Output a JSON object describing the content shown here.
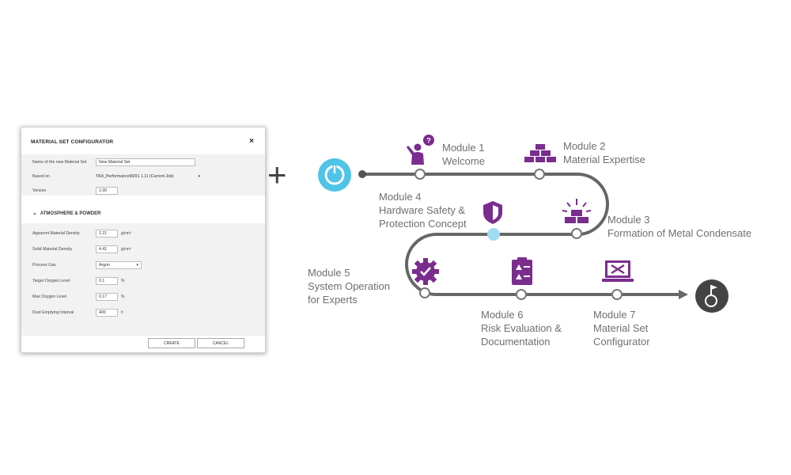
{
  "dialog": {
    "title": "MATERIAL SET CONFIGURATOR",
    "close_symbol": "×",
    "fields": {
      "name_label": "Name of the new Material Set",
      "name_value": "New Material Set",
      "based_on_label": "Based on",
      "based_on_value": "Ti64_PerformanceM291 1.11 (Current Job)",
      "version_label": "Version",
      "version_value": "1.00"
    },
    "section_title": "ATMOSPHERE & POWDER",
    "params": {
      "apparent_density_label": "Apparent Material Density",
      "apparent_density_value": "2.21",
      "apparent_density_unit": "g/cm³",
      "solid_density_label": "Solid Material Density",
      "solid_density_value": "4.41",
      "solid_density_unit": "g/cm³",
      "process_gas_label": "Process Gas",
      "process_gas_value": "Argon",
      "target_oxygen_label": "Target Oxygen Level",
      "target_oxygen_value": "0.1",
      "target_oxygen_unit": "%",
      "max_oxygen_label": "Max Oxygen Level",
      "max_oxygen_value": "0.17",
      "max_oxygen_unit": "%",
      "dust_interval_label": "Dust Emptying Interval",
      "dust_interval_value": "400",
      "dust_interval_unit": "h"
    },
    "buttons": {
      "create": "CREATE",
      "cancel": "CANCEL"
    }
  },
  "plus_symbol": "+",
  "roadmap": {
    "colors": {
      "path": "#666666",
      "accent": "#7b2d8e",
      "start": "#4fc3e8",
      "end": "#444444"
    },
    "modules": [
      {
        "line1": "Module 1",
        "line2": "Welcome",
        "line3": "",
        "icon": "person-help-icon"
      },
      {
        "line1": "Module 2",
        "line2": "Material Expertise",
        "line3": "",
        "icon": "metal-bars-icon"
      },
      {
        "line1": "Module 3",
        "line2": "Formation of Metal Condensate",
        "line3": "",
        "icon": "glowing-bars-icon"
      },
      {
        "line1": "Module 4",
        "line2": "Hardware Safety &",
        "line3": "Protection Concept",
        "icon": "shield-icon"
      },
      {
        "line1": "Module 5",
        "line2": "System Operation",
        "line3": "for Experts",
        "icon": "gear-check-icon"
      },
      {
        "line1": "Module 6",
        "line2": "Risk Evaluation &",
        "line3": "Documentation",
        "icon": "clipboard-warning-icon"
      },
      {
        "line1": "Module 7",
        "line2": "Material Set",
        "line3": "Configurator",
        "icon": "laptop-tools-icon"
      }
    ]
  }
}
